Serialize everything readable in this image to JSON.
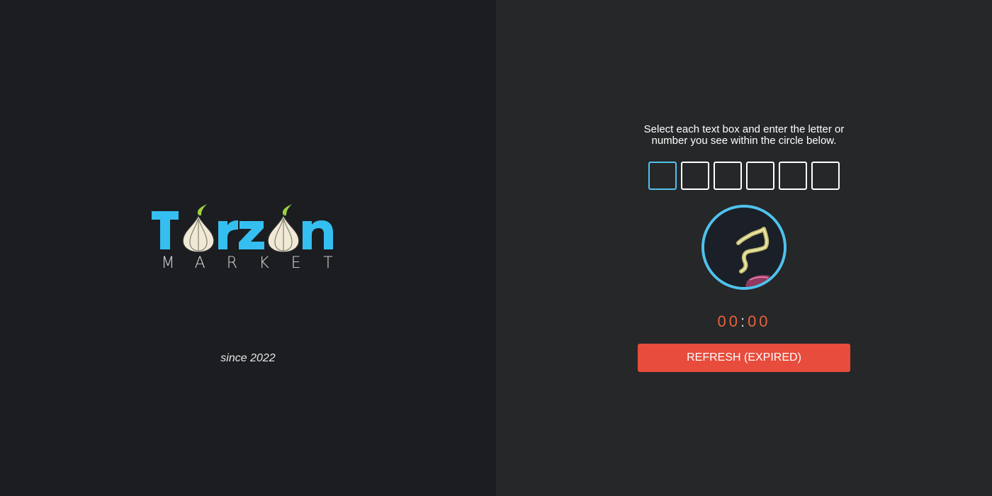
{
  "brand": {
    "name": "Torzon",
    "subtitle_letters": [
      "M",
      "A",
      "R",
      "K",
      "E",
      "T"
    ],
    "since": "since 2022",
    "colors": {
      "accent": "#35bff0",
      "onion": "#efe9d6",
      "sprout": "#9bd23c"
    }
  },
  "captcha": {
    "instructions": "Select each text box and enter the letter or number you see within the circle below.",
    "boxes": [
      "",
      "",
      "",
      "",
      "",
      ""
    ],
    "active_box": 0,
    "timer": {
      "minutes": "00",
      "separator": ":",
      "seconds": "00"
    },
    "refresh_label": "REFRESH (EXPIRED)"
  },
  "colors": {
    "left_bg": "#1b1d21",
    "right_bg": "#262729",
    "accent_blue": "#4fc3ec",
    "timer": "#e8623f",
    "button": "#e74c3c"
  }
}
